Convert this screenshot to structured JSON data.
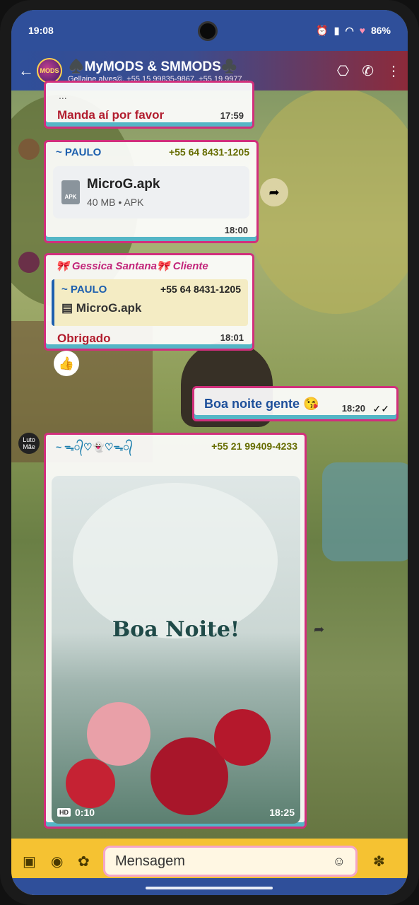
{
  "status": {
    "time": "19:08",
    "battery": "86%"
  },
  "header": {
    "back_icon": "arrow-left-icon",
    "avatar_text": "MODS",
    "title": "♠️MyMODS & SMMODS♣️",
    "subtitle": "Gellaine alves©, +55 15 99835-9867, +55 19 9977..."
  },
  "messages": [
    {
      "text": "Manda aí por favor",
      "time": "17:59"
    },
    {
      "sender": "~ PAULO",
      "phone": "+55 64 8431-1205",
      "file_name": "MicroG.apk",
      "file_meta": "40 MB • APK",
      "file_badge": "APK",
      "time": "18:00"
    },
    {
      "sender": "🎀 Gessica Santana🎀 Cliente",
      "quote_sender": "~ PAULO",
      "quote_phone": "+55 64 8431-1205",
      "quote_file": "MicroG.apk",
      "text": "Obrigado",
      "time": "18:01",
      "reaction": "👍"
    },
    {
      "text": "Boa noite gente 😘",
      "time": "18:20"
    },
    {
      "sender": "~ ᯓ᭄♡👻♡ᯓ᭄",
      "phone": "+55 21 99409-4233",
      "image_caption": "Boa Noite!",
      "hd_label": "HD",
      "duration": "0:10",
      "time": "18:25",
      "luto_label": "Luto Mãe"
    }
  ],
  "composer": {
    "placeholder": "Mensagem"
  },
  "colors": {
    "accent": "#d12f7c",
    "sender_blue": "#1d5fae",
    "bottom_bar": "#f5c232"
  }
}
